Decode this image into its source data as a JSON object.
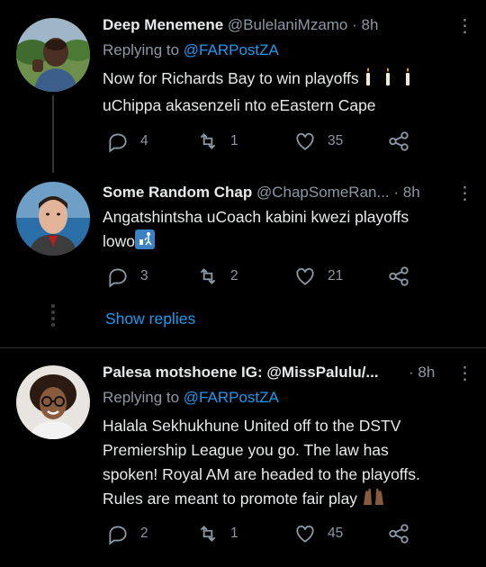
{
  "tweets": [
    {
      "name": "Deep Menemene",
      "handle": "@BulelaniMzamo",
      "dot": "·",
      "time": "8h",
      "replying_label": "Replying to",
      "replying_to": "@FARPostZA",
      "lines": [
        "Now for Richards Bay to win playoffs",
        "uChippa akasenzeli nto eEastern Cape"
      ],
      "emoji_after_line1": "candle",
      "replies": "4",
      "retweets": "1",
      "likes": "35"
    },
    {
      "name": "Some Random Chap",
      "handle": "@ChapSomeRan...",
      "dot": "·",
      "time": "8h",
      "lines": [
        "Angatshintsha uCoach kabini kwezi playoffs",
        "lowo"
      ],
      "emoji_after_line2": "wastebasket",
      "replies": "3",
      "retweets": "2",
      "likes": "21"
    },
    {
      "name": "Palesa motshoene IG: @MissPalulu/...",
      "dot": "·",
      "time": "8h",
      "replying_label": "Replying to",
      "replying_to": "@FARPostZA",
      "lines": [
        "Halala Sekhukhune United off to the DSTV",
        "Premiership League you go. The law has",
        "spoken! Royal AM are headed to the playoffs.",
        "Rules are meant to promote fair play"
      ],
      "emoji_after_line4": "raising-hands",
      "replies": "2",
      "retweets": "1",
      "likes": "45"
    }
  ],
  "show_replies": "Show replies",
  "colors": {
    "background": "#000000",
    "link": "#1d9bf0",
    "muted": "#8b98a5",
    "text": "#e7e9ea"
  },
  "icons": [
    "reply-icon",
    "retweet-icon",
    "like-icon",
    "share-icon",
    "more-icon"
  ]
}
